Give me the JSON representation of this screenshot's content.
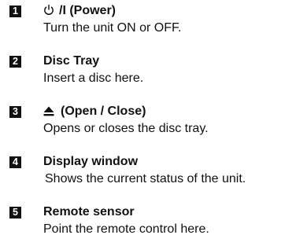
{
  "items": [
    {
      "number": "1",
      "title": "/I (Power)",
      "description": "Turn the unit ON or OFF.",
      "icon": "power-icon"
    },
    {
      "number": "2",
      "title": "Disc Tray",
      "description": "Insert a disc here."
    },
    {
      "number": "3",
      "title": "(Open / Close)",
      "description": "Opens or closes the disc tray.",
      "icon": "eject-icon"
    },
    {
      "number": "4",
      "title": "Display window",
      "description": "Shows the current status of the unit."
    },
    {
      "number": "5",
      "title": "Remote sensor",
      "description": "Point the remote control here."
    }
  ]
}
